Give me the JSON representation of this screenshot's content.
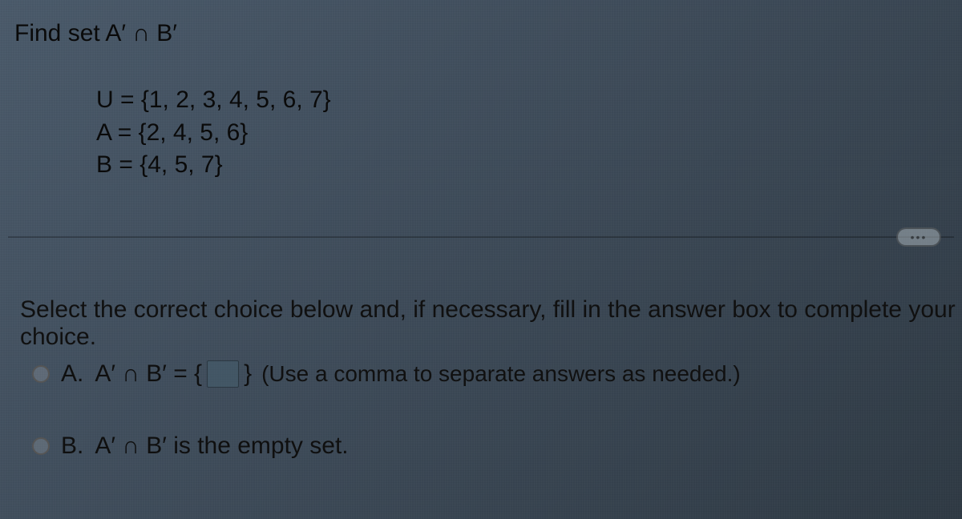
{
  "question": {
    "title": "Find set A′ ∩ B′"
  },
  "given": {
    "U": "U = {1, 2, 3, 4, 5, 6, 7}",
    "A": "A = {2, 4, 5, 6}",
    "B": "B = {4, 5, 7}"
  },
  "ellipsis": "•••",
  "instruction": "Select the correct choice below and, if necessary, fill in the answer box to complete your choice.",
  "choices": {
    "A": {
      "label": "A.",
      "prefix": "A′ ∩ B′ = {",
      "suffix": "}",
      "hint": "(Use a comma to separate answers as needed.)"
    },
    "B": {
      "label": "B.",
      "text": "A′ ∩ B′ is the empty set."
    }
  }
}
